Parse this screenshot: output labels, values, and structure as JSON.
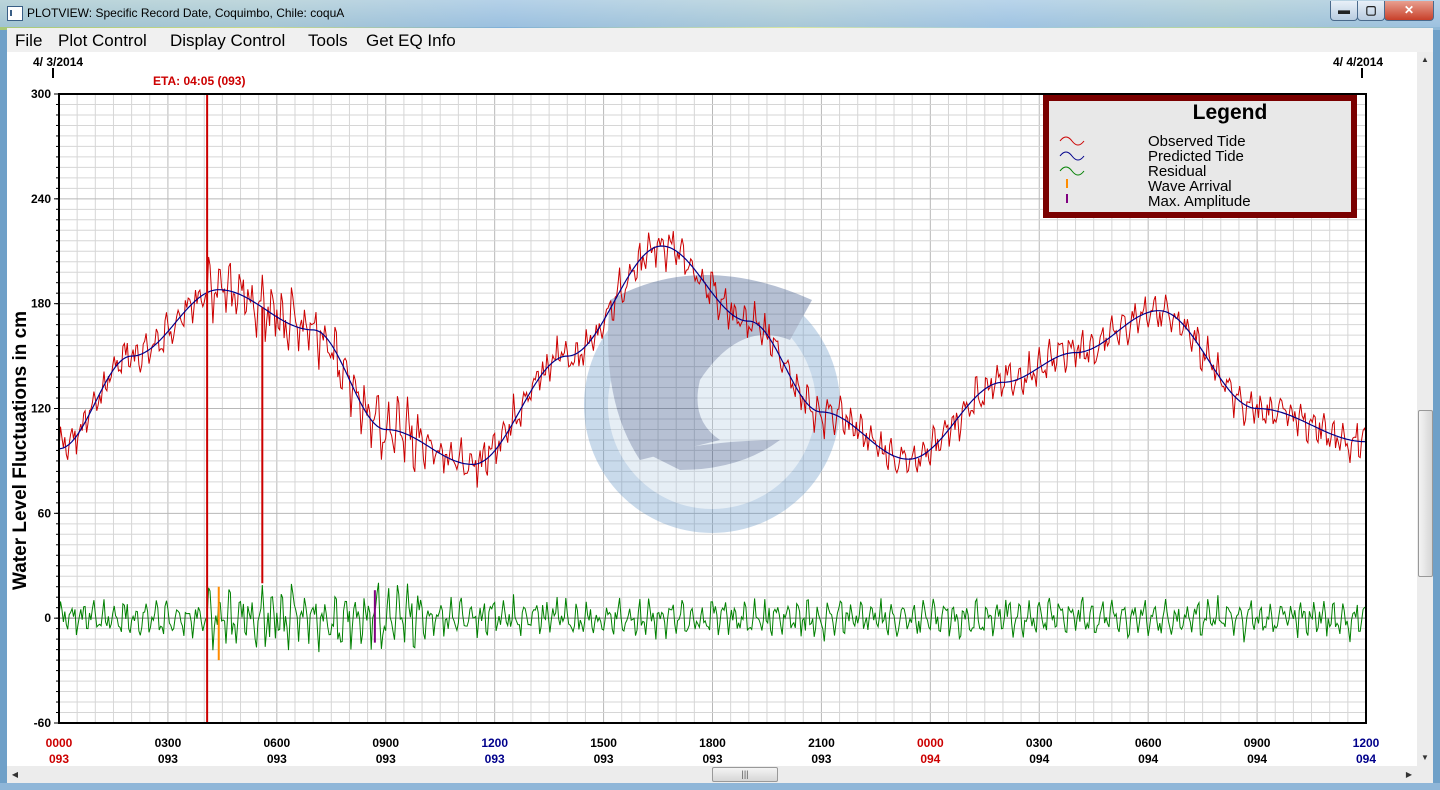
{
  "window": {
    "title": "PLOTVIEW: Specific Record Date, Coquimbo, Chile: coquA",
    "icon": "app-window-icon"
  },
  "controls": {
    "minimize": "▬",
    "maximize": "▢",
    "close": "✕"
  },
  "menu": [
    "File",
    "Plot Control",
    "Display Control",
    "Tools",
    "Get EQ Info"
  ],
  "plot": {
    "date_left": "4/ 3/2014",
    "date_right": "4/ 4/2014",
    "eta_label": "ETA: 04:05 (093)",
    "ylabel": "Water Level Fluctuations in cm",
    "colors": {
      "observed": "#cc0000",
      "predicted": "#00008b",
      "residual": "#008000",
      "wave_arrival": "#ff8c00",
      "max_amplitude": "#800080",
      "eta_line": "#cc0000"
    }
  },
  "legend": {
    "title": "Legend",
    "items": [
      {
        "label": "Observed Tide",
        "color": "#cc0000"
      },
      {
        "label": "Predicted Tide",
        "color": "#00008b"
      },
      {
        "label": "Residual",
        "color": "#008000"
      },
      {
        "label": "Wave Arrival",
        "color": "#ff8c00"
      },
      {
        "label": "Max. Amplitude",
        "color": "#800080"
      }
    ]
  },
  "chart_data": {
    "type": "line",
    "ylabel": "Water Level Fluctuations in cm",
    "ylim": [
      -60,
      300
    ],
    "yticks": [
      -60,
      0,
      60,
      120,
      180,
      240,
      300
    ],
    "xlim_hours": [
      0,
      36
    ],
    "xticks": [
      {
        "time": "0000",
        "day": "093",
        "color": "#cc0000"
      },
      {
        "time": "0300",
        "day": "093",
        "color": "#000000"
      },
      {
        "time": "0600",
        "day": "093",
        "color": "#000000"
      },
      {
        "time": "0900",
        "day": "093",
        "color": "#000000"
      },
      {
        "time": "1200",
        "day": "093",
        "color": "#00008b"
      },
      {
        "time": "1500",
        "day": "093",
        "color": "#000000"
      },
      {
        "time": "1800",
        "day": "093",
        "color": "#000000"
      },
      {
        "time": "2100",
        "day": "093",
        "color": "#000000"
      },
      {
        "time": "0000",
        "day": "094",
        "color": "#cc0000"
      },
      {
        "time": "0300",
        "day": "094",
        "color": "#000000"
      },
      {
        "time": "0600",
        "day": "094",
        "color": "#000000"
      },
      {
        "time": "0900",
        "day": "094",
        "color": "#000000"
      },
      {
        "time": "1200",
        "day": "094",
        "color": "#00008b"
      }
    ],
    "eta_hour": 4.08,
    "wave_arrival_hour": 4.4,
    "max_amplitude_hour": 8.7,
    "spike_hour": 5.6,
    "predicted_tide": {
      "hours": [
        0,
        2,
        4.4,
        7,
        9,
        11.4,
        14,
        16.6,
        19,
        21,
        23.4,
        26,
        28,
        30.3,
        33,
        36
      ],
      "values": [
        97,
        150,
        188,
        165,
        108,
        88,
        150,
        213,
        170,
        118,
        91,
        135,
        152,
        176,
        120,
        101
      ]
    },
    "grid": true,
    "legend_position": "top-right"
  }
}
